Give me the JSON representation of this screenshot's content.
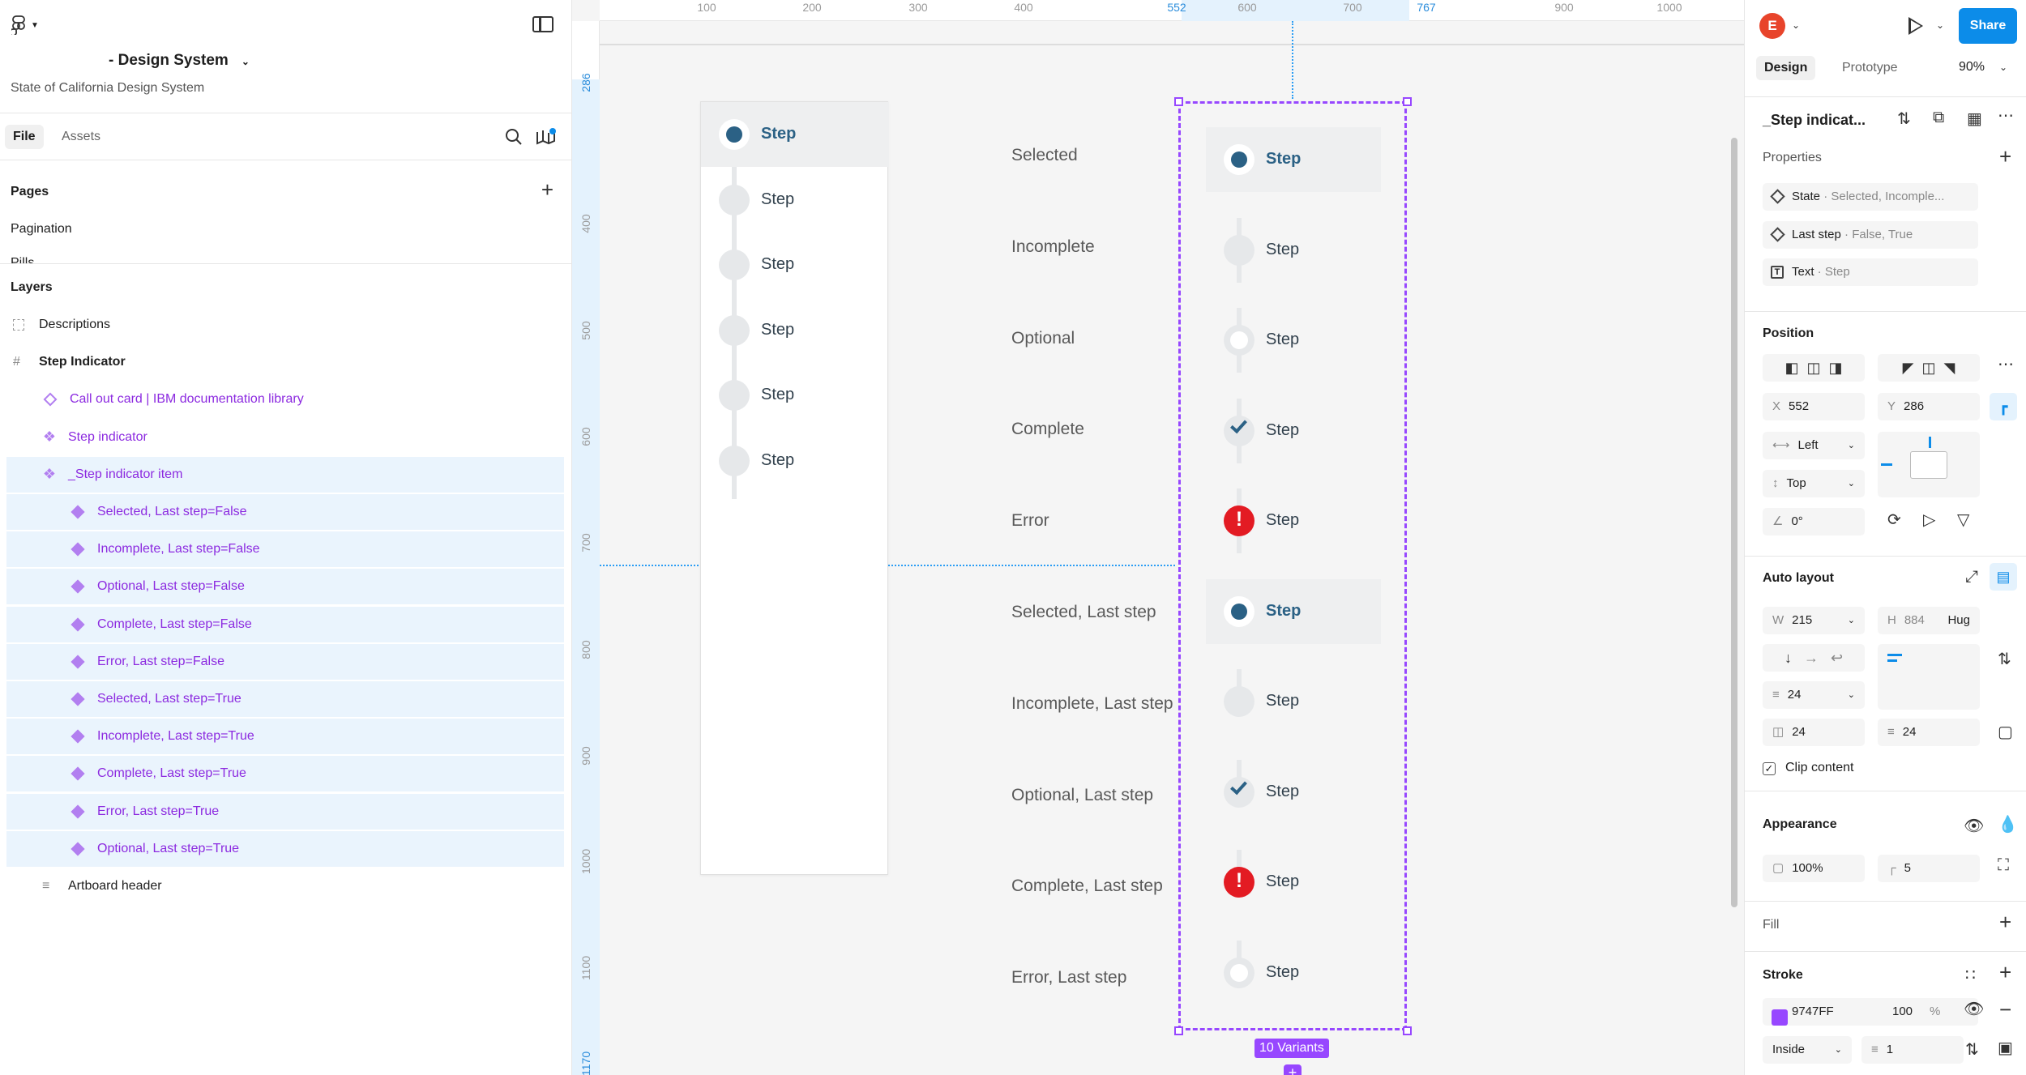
{
  "left_panel": {
    "file_name": "- Design System",
    "file_subtitle": "State of California Design System",
    "tabs": [
      "File",
      "Assets"
    ],
    "pages_title": "Pages",
    "pages": [
      "Pagination",
      "Pills"
    ],
    "layers_title": "Layers",
    "layers": [
      {
        "label": "Descriptions",
        "icon": "dashed-frame-icon",
        "indent": 0,
        "bold": false,
        "color": "default"
      },
      {
        "label": "Step Indicator",
        "icon": "frame-hash-icon",
        "indent": 0,
        "bold": true,
        "color": "default"
      },
      {
        "label": "Call out card | IBM documentation library",
        "icon": "instance-icon",
        "indent": 1,
        "bold": false,
        "color": "purple"
      },
      {
        "label": "Step indicator",
        "icon": "component-set-icon",
        "indent": 1,
        "bold": false,
        "color": "purple"
      },
      {
        "label": "_Step indicator item",
        "icon": "component-set-icon",
        "indent": 1,
        "bold": false,
        "color": "purple",
        "selected": true
      },
      {
        "label": "Selected, Last step=False",
        "icon": "variant-icon",
        "indent": 2,
        "color": "purple"
      },
      {
        "label": "Incomplete, Last step=False",
        "icon": "variant-icon",
        "indent": 2,
        "color": "purple"
      },
      {
        "label": "Optional, Last step=False",
        "icon": "variant-icon",
        "indent": 2,
        "color": "purple"
      },
      {
        "label": "Complete, Last step=False",
        "icon": "variant-icon",
        "indent": 2,
        "color": "purple"
      },
      {
        "label": "Error, Last step=False",
        "icon": "variant-icon",
        "indent": 2,
        "color": "purple"
      },
      {
        "label": "Selected, Last step=True",
        "icon": "variant-icon",
        "indent": 2,
        "color": "purple"
      },
      {
        "label": "Incomplete, Last step=True",
        "icon": "variant-icon",
        "indent": 2,
        "color": "purple"
      },
      {
        "label": "Complete, Last step=True",
        "icon": "variant-icon",
        "indent": 2,
        "color": "purple"
      },
      {
        "label": "Error, Last step=True",
        "icon": "variant-icon",
        "indent": 2,
        "color": "purple"
      },
      {
        "label": "Optional, Last step=True",
        "icon": "variant-icon",
        "indent": 2,
        "color": "purple"
      },
      {
        "label": "Artboard header",
        "icon": "text-block-icon",
        "indent": 1,
        "bold": false,
        "color": "default"
      }
    ]
  },
  "canvas": {
    "ruler_top": [
      "100",
      "200",
      "300",
      "400",
      "552",
      "600",
      "700",
      "767",
      "900",
      "1000"
    ],
    "ruler_left": [
      "286",
      "400",
      "500",
      "600",
      "700",
      "800",
      "900",
      "1000",
      "1100",
      "1170"
    ],
    "card_steps": [
      {
        "label": "Step",
        "state": "selected"
      },
      {
        "label": "Step",
        "state": "incomplete"
      },
      {
        "label": "Step",
        "state": "incomplete"
      },
      {
        "label": "Step",
        "state": "incomplete"
      },
      {
        "label": "Step",
        "state": "incomplete"
      },
      {
        "label": "Step",
        "state": "incomplete"
      }
    ],
    "descriptions": [
      "Selected",
      "Incomplete",
      "Optional",
      "Complete",
      "Error",
      "Selected, Last step",
      "Incomplete, Last step",
      "Optional, Last step",
      "Complete, Last step",
      "Error, Last step"
    ],
    "variants": [
      {
        "label": "Step",
        "state": "selected"
      },
      {
        "label": "Step",
        "state": "incomplete"
      },
      {
        "label": "Step",
        "state": "optional"
      },
      {
        "label": "Step",
        "state": "complete"
      },
      {
        "label": "Step",
        "state": "error"
      },
      {
        "label": "Step",
        "state": "selected"
      },
      {
        "label": "Step",
        "state": "incomplete"
      },
      {
        "label": "Step",
        "state": "complete"
      },
      {
        "label": "Step",
        "state": "error"
      },
      {
        "label": "Step",
        "state": "optional"
      }
    ],
    "variants_badge": "10 Variants",
    "colors": {
      "selection": "#9747FF",
      "step_blue": "#2B6185",
      "error_red": "#E31B23",
      "guide": "#2A9DF4"
    }
  },
  "right_panel": {
    "avatar_initial": "E",
    "share": "Share",
    "tabs": [
      "Design",
      "Prototype"
    ],
    "zoom": "90%",
    "component_name": "_Step indicat...",
    "properties_title": "Properties",
    "properties": [
      {
        "name": "State",
        "value": " · Selected, Incomple..."
      },
      {
        "name": "Last step",
        "value": " · False, True"
      },
      {
        "name": "Text",
        "value": " · Step"
      }
    ],
    "position_title": "Position",
    "x_label": "X",
    "x": "552",
    "y_label": "Y",
    "y": "286",
    "constraint_h": "Left",
    "constraint_v": "Top",
    "rotation": "0°",
    "auto_layout_title": "Auto layout",
    "w_label": "W",
    "w": "215",
    "h_label": "H",
    "h": "884",
    "h_mode": "Hug",
    "gap": "24",
    "padding_h": "24",
    "padding_v": "24",
    "clip_content": "Clip content",
    "appearance_title": "Appearance",
    "opacity": "100%",
    "radius": "5",
    "fill_title": "Fill",
    "stroke_title": "Stroke",
    "stroke_color": "9747FF",
    "stroke_opacity": "100",
    "stroke_pct": "%",
    "stroke_position": "Inside",
    "stroke_weight": "1"
  }
}
